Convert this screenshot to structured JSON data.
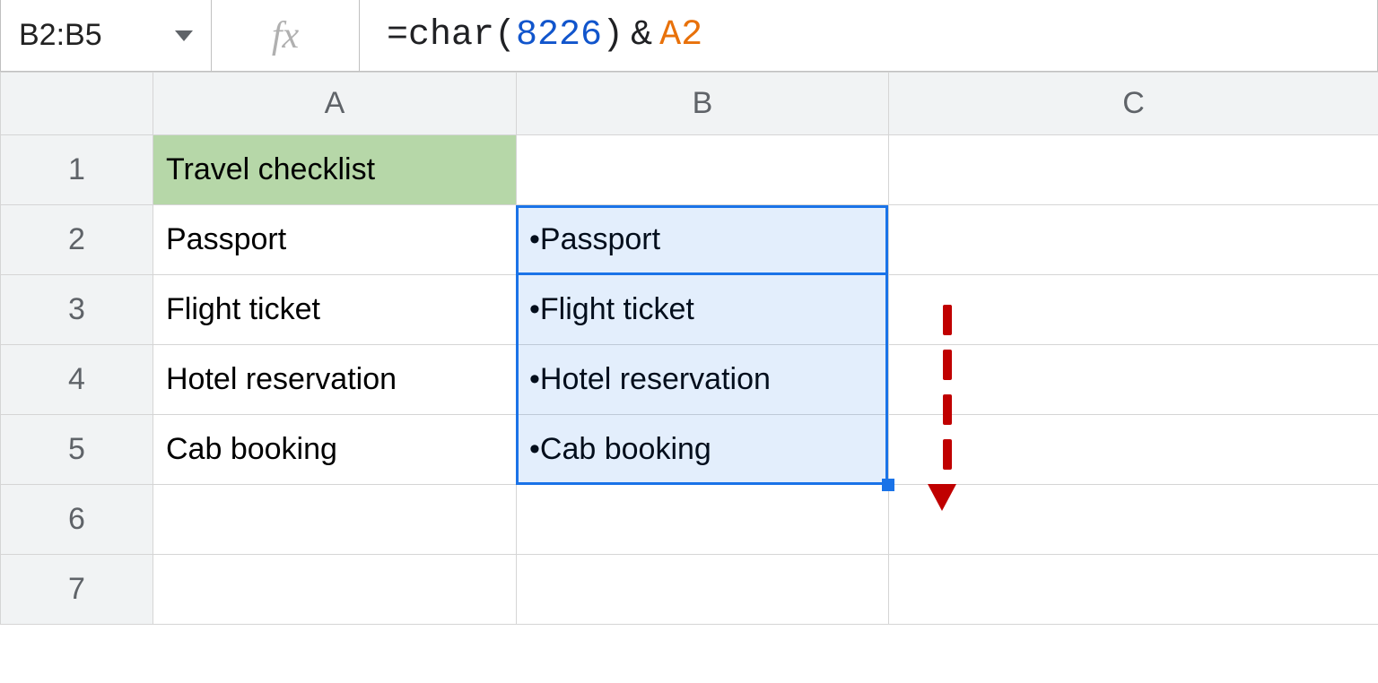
{
  "formula_bar": {
    "name_box": "B2:B5",
    "formula": {
      "eq": "=",
      "func": "char",
      "open": "(",
      "num": "8226",
      "close": ")",
      "amp": "&",
      "ref": "A2"
    }
  },
  "columns": [
    "A",
    "B",
    "C"
  ],
  "row_headers": [
    "1",
    "2",
    "3",
    "4",
    "5",
    "6",
    "7"
  ],
  "cells": {
    "A1": "Travel checklist",
    "A2": "Passport",
    "A3": "Flight ticket",
    "A4": "Hotel reservation",
    "A5": "Cab booking",
    "B2": "•Passport",
    "B3": "•Flight ticket",
    "B4": "•Hotel reservation",
    "B5": "•Cab booking"
  }
}
